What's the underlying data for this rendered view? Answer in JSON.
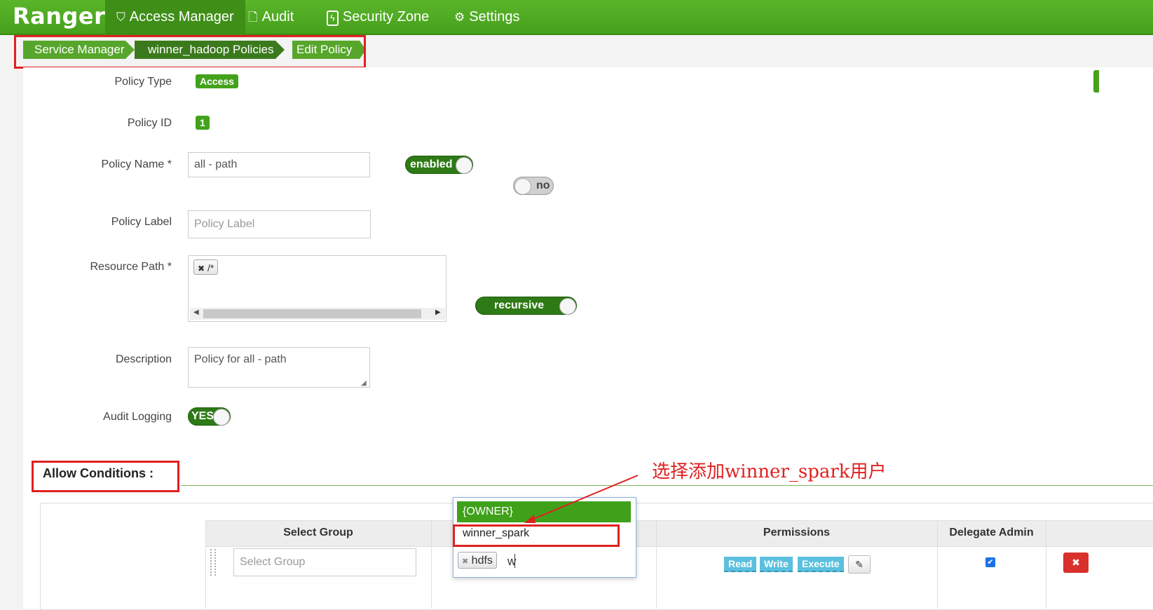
{
  "app": {
    "brand": "Ranger"
  },
  "nav": {
    "items": [
      {
        "label": "Access Manager",
        "icon": "shield-icon"
      },
      {
        "label": "Audit",
        "icon": "file-icon"
      },
      {
        "label": "Security Zone",
        "icon": "zone-bolt-icon"
      },
      {
        "label": "Settings",
        "icon": "gear-icon"
      }
    ]
  },
  "breadcrumb": [
    "Service Manager",
    "winner_hadoop Policies",
    "Edit Policy"
  ],
  "form": {
    "policy_type_label": "Policy Type",
    "policy_type_value": "Access",
    "policy_id_label": "Policy ID",
    "policy_id_value": "1",
    "policy_name_label": "Policy Name *",
    "policy_name_value": "all - path",
    "enabled_toggle": "enabled",
    "normal_toggle": "no",
    "policy_label_label": "Policy Label",
    "policy_label_placeholder": "Policy Label",
    "resource_path_label": "Resource Path *",
    "resource_path_tag": "/*",
    "recursive_toggle": "recursive",
    "description_label": "Description",
    "description_value": "Policy for all - path",
    "audit_logging_label": "Audit Logging",
    "audit_logging_value": "YES"
  },
  "allow_conditions": {
    "title": "Allow Conditions :",
    "headers": {
      "group": "Select Group",
      "permissions": "Permissions",
      "delegate": "Delegate Admin"
    },
    "row": {
      "group_placeholder": "Select Group",
      "user_tag": "hdfs",
      "user_typed": "w",
      "permissions": [
        "Read",
        "Write",
        "Execute"
      ],
      "delegate_admin": true
    },
    "dropdown_options": [
      "{OWNER}",
      "winner_spark"
    ]
  },
  "annotation": "选择添加winner_spark用户",
  "colors": {
    "primary": "#46a01c",
    "highlight": "#e02020",
    "permission": "#5bc0de"
  }
}
